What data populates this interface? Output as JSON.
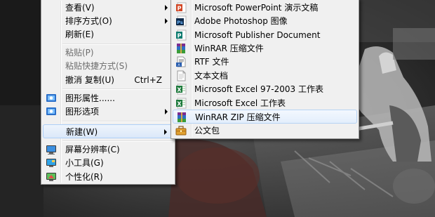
{
  "context_menu": {
    "items": [
      {
        "label": "查看(V)"
      },
      {
        "label": "排序方式(O)"
      },
      {
        "label": "刷新(E)"
      },
      {
        "label": "粘贴(P)"
      },
      {
        "label": "粘贴快捷方式(S)"
      },
      {
        "label": "撤消 复制(U)",
        "shortcut": "Ctrl+Z"
      },
      {
        "label": "图形属性......"
      },
      {
        "label": "图形选项"
      },
      {
        "label": "新建(W)"
      },
      {
        "label": "屏幕分辨率(C)"
      },
      {
        "label": "小工具(G)"
      },
      {
        "label": "个性化(R)"
      }
    ]
  },
  "new_submenu": {
    "items": [
      {
        "label": "Microsoft PowerPoint 演示文稿",
        "icon": "powerpoint-icon"
      },
      {
        "label": "Adobe Photoshop 图像",
        "icon": "photoshop-icon"
      },
      {
        "label": "Microsoft Publisher Document",
        "icon": "publisher-icon"
      },
      {
        "label": "WinRAR 压缩文件",
        "icon": "winrar-icon"
      },
      {
        "label": "RTF 文件",
        "icon": "rtf-document-icon"
      },
      {
        "label": "文本文档",
        "icon": "text-document-icon"
      },
      {
        "label": "Microsoft Excel 97-2003 工作表",
        "icon": "excel-97-icon"
      },
      {
        "label": "Microsoft Excel 工作表",
        "icon": "excel-icon"
      },
      {
        "label": "WinRAR ZIP 压缩文件",
        "icon": "winrar-zip-icon"
      },
      {
        "label": "公文包",
        "icon": "briefcase-icon"
      }
    ]
  },
  "colors": {
    "menu_bg": "#f0f0f0",
    "hover_border": "#aecff7",
    "disabled_text": "#6d6d6d"
  }
}
